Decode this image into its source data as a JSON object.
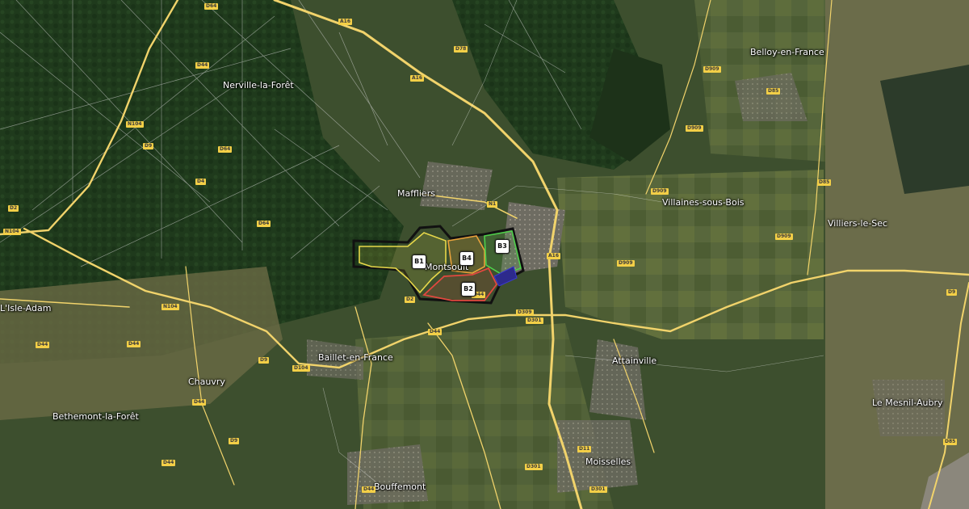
{
  "places": [
    "Nerville-la-Forêt",
    "Belloy-en-France",
    "Maffliers",
    "Villaines-sous-Bois",
    "Villiers-le-Sec",
    "Montsoult",
    "Baillet-en-France",
    "Attainville",
    "Chauvry",
    "Bethemont-la-Forêt",
    "Le Mesnil-Aubry",
    "Moisselles",
    "Bouffemont",
    "L'Isle-Adam"
  ],
  "roads": [
    "D64",
    "A16",
    "D78",
    "A16",
    "D44",
    "D909",
    "D85",
    "N104",
    "D9",
    "D4",
    "D909",
    "D64",
    "D85",
    "N1",
    "D909",
    "D909",
    "D2",
    "D64",
    "A16",
    "D309",
    "D909",
    "N104",
    "D2",
    "D44",
    "D301",
    "N104",
    "D9",
    "D44",
    "D104",
    "D44",
    "D44",
    "D44",
    "D301",
    "D11",
    "D44",
    "D301",
    "D9",
    "D44",
    "D85",
    "D9"
  ],
  "markers": [
    "B1",
    "B4",
    "B3",
    "B2"
  ],
  "colors": {
    "outline": "#111111",
    "b1": "#e7d84a",
    "b2": "#e2483f",
    "b3": "#4fd14b",
    "b4": "#e9a23b",
    "road": "#f1d36b"
  }
}
